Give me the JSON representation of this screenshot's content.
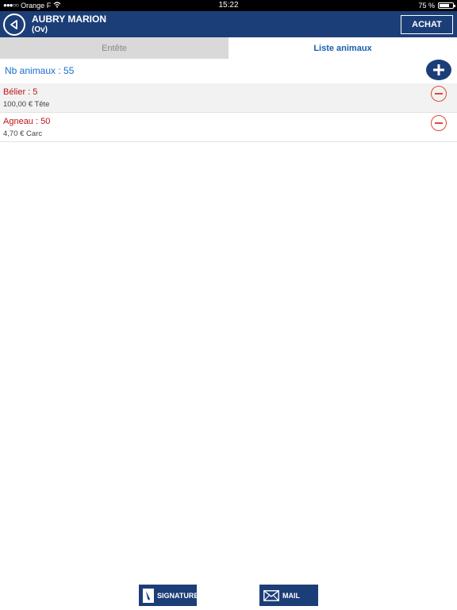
{
  "status_bar": {
    "carrier": "Orange F",
    "time": "15:22",
    "battery_text": "75 %",
    "battery_level": 0.75
  },
  "header": {
    "name": "AUBRY MARION",
    "subtitle": "(Ov)",
    "action_label": "ACHAT"
  },
  "tabs": [
    {
      "label": "Entête",
      "active": false
    },
    {
      "label": "Liste animaux",
      "active": true
    }
  ],
  "summary": {
    "count_label": "Nb animaux : 55"
  },
  "animals": [
    {
      "title": "Bélier : 5",
      "price": "100,00 € Tête"
    },
    {
      "title": "Agneau : 50",
      "price": "4,70 € Carc"
    }
  ],
  "footer": {
    "signature_label": "SIGNATURE",
    "mail_label": "MAIL"
  },
  "colors": {
    "brand": "#1c3e78",
    "accent_text": "#1a6fd0",
    "item_title": "#c0141a",
    "remove": "#e4473a"
  },
  "icons": [
    "back-icon",
    "plus-icon",
    "minus-icon",
    "signature-icon",
    "mail-icon",
    "wifi-icon",
    "battery-icon"
  ]
}
